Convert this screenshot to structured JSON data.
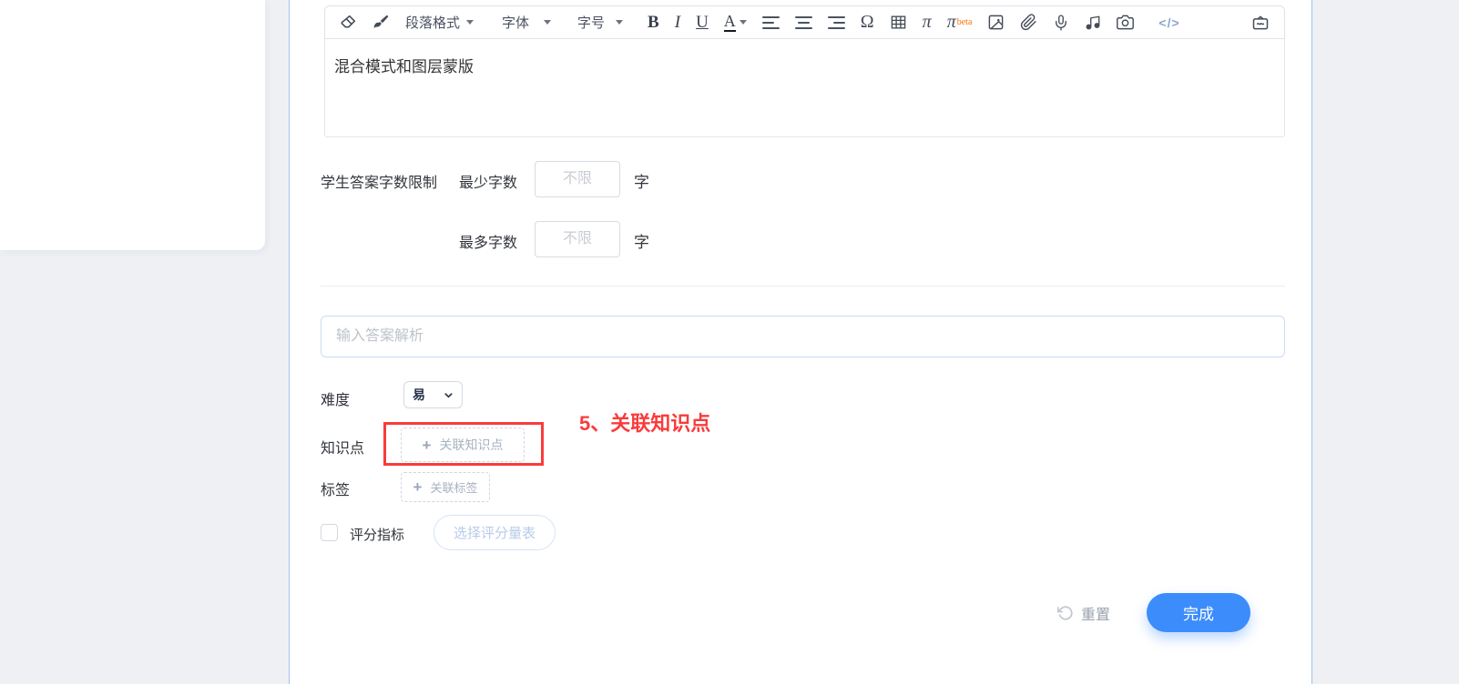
{
  "colors": {
    "accent_blue": "#3c8cfc",
    "annotation_red": "#f93b3b",
    "page_bg": "#eef0f4"
  },
  "editor": {
    "toolbar": {
      "paragraph_format": "段落格式",
      "font": "字体",
      "font_size": "字号",
      "bold": "B",
      "italic": "I",
      "underline": "U",
      "font_color": "A",
      "special_char": "Ω",
      "formula": "π",
      "formula_beta": "π",
      "beta_tag": "beta",
      "code": "</>",
      "icons": [
        "eraser-icon",
        "format-brush-icon",
        "align-left-icon",
        "align-center-icon",
        "align-right-icon",
        "table-icon",
        "image-icon",
        "paperclip-icon",
        "microphone-icon",
        "music-icon",
        "camera-icon",
        "code-icon",
        "toolbox-icon"
      ]
    },
    "content": "混合模式和图层蒙版"
  },
  "word_limit": {
    "label": "学生答案字数限制",
    "min_label": "最少字数",
    "max_label": "最多字数",
    "placeholder": "不限",
    "unit": "字"
  },
  "analysis": {
    "placeholder": "输入答案解析"
  },
  "difficulty": {
    "label": "难度",
    "value": "易"
  },
  "annotation": {
    "text": "5、关联知识点"
  },
  "knowledge": {
    "label": "知识点",
    "button": "关联知识点"
  },
  "tags": {
    "label": "标签",
    "button": "关联标签"
  },
  "scoring": {
    "label": "评分指标",
    "button": "选择评分量表"
  },
  "footer": {
    "reset": "重置",
    "done": "完成"
  }
}
